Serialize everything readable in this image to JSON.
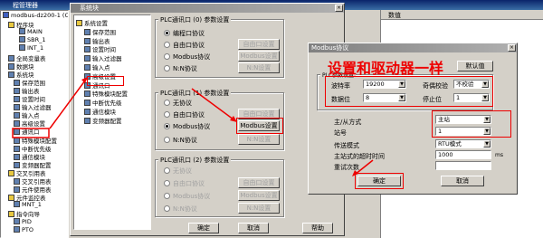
{
  "app": {
    "title": "程管理器"
  },
  "tree": {
    "items": [
      {
        "label": "modbus-dz200-1 (CW",
        "indent": 0,
        "icon": "project-icon"
      },
      {
        "label": "程序块",
        "indent": 1,
        "icon": "folder-icon"
      },
      {
        "label": "MAIN",
        "indent": 3,
        "icon": "block-icon"
      },
      {
        "label": "SBR_1",
        "indent": 3,
        "icon": "block-icon"
      },
      {
        "label": "INT_1",
        "indent": 3,
        "icon": "block-icon"
      },
      {
        "label": "全局变量表",
        "indent": 1,
        "icon": "table-icon"
      },
      {
        "label": "数据块",
        "indent": 1,
        "icon": "data-icon"
      },
      {
        "label": "系统块",
        "indent": 1,
        "icon": "system-icon"
      },
      {
        "label": "保存范围",
        "indent": 2,
        "icon": "item-icon"
      },
      {
        "label": "输出表",
        "indent": 2,
        "icon": "item-icon"
      },
      {
        "label": "设置时间",
        "indent": 2,
        "icon": "item-icon"
      },
      {
        "label": "输入过滤器",
        "indent": 2,
        "icon": "item-icon"
      },
      {
        "label": "输入点",
        "indent": 2,
        "icon": "item-icon"
      },
      {
        "label": "高级设置",
        "indent": 2,
        "icon": "item-icon"
      },
      {
        "label": "通讯口",
        "indent": 2,
        "icon": "item-icon"
      },
      {
        "label": "特殊模块配置",
        "indent": 2,
        "icon": "item-icon"
      },
      {
        "label": "中断优先级",
        "indent": 2,
        "icon": "item-icon"
      },
      {
        "label": "通信模块",
        "indent": 2,
        "icon": "item-icon"
      },
      {
        "label": "变频器配置",
        "indent": 2,
        "icon": "item-icon"
      },
      {
        "label": "交叉引用表",
        "indent": 1,
        "icon": "folder-icon"
      },
      {
        "label": "交叉引用表",
        "indent": 2,
        "icon": "item-icon"
      },
      {
        "label": "元件使用表",
        "indent": 2,
        "icon": "item-icon"
      },
      {
        "label": "元件监控表",
        "indent": 1,
        "icon": "folder-icon"
      },
      {
        "label": "MNT_1",
        "indent": 2,
        "icon": "item-icon"
      },
      {
        "label": "指令向导",
        "indent": 1,
        "icon": "folder-icon"
      },
      {
        "label": "PID",
        "indent": 2,
        "icon": "item-icon"
      },
      {
        "label": "PTO",
        "indent": 2,
        "icon": "item-icon"
      }
    ]
  },
  "bg_panel": {
    "header": "数值"
  },
  "sysblock": {
    "title": "系统块",
    "nav": [
      {
        "label": "系统设置",
        "indent": 0
      },
      {
        "label": "保存范围",
        "indent": 1
      },
      {
        "label": "输出表",
        "indent": 1
      },
      {
        "label": "设置时间",
        "indent": 1
      },
      {
        "label": "输入过滤器",
        "indent": 1
      },
      {
        "label": "输入点",
        "indent": 1
      },
      {
        "label": "高级设置",
        "indent": 1
      },
      {
        "label": "通讯口",
        "indent": 1
      },
      {
        "label": "特殊模块配置",
        "indent": 1
      },
      {
        "label": "中断优先级",
        "indent": 1
      },
      {
        "label": "通信模块",
        "indent": 1
      },
      {
        "label": "变频器配置",
        "indent": 1
      }
    ],
    "group0": {
      "title": "PLC通讯口 (0) 参数设置",
      "options": [
        "编程口协议",
        "自由口协议",
        "Modbus协议",
        "N:N协议"
      ],
      "buttons": [
        "自由口设置",
        "Modbus设置",
        "N:N设置"
      ]
    },
    "group1": {
      "title": "PLC通讯口 (1) 参数设置",
      "options": [
        "无协议",
        "自由口协议",
        "Modbus协议",
        "N:N协议"
      ],
      "buttons": [
        "自由口设置",
        "Modbus设置",
        "N:N设置"
      ]
    },
    "group2": {
      "title": "PLC通讯口 (2) 参数设置",
      "options": [
        "无协议",
        "自由口协议",
        "Modbus协议",
        "N:N协议"
      ],
      "buttons": [
        "自由口设置",
        "Modbus设置",
        "N:N设置"
      ]
    },
    "ok": "确定",
    "cancel": "取消",
    "help": "帮助"
  },
  "modbus": {
    "title": "Modbus协议",
    "annotation": "设置和驱动器一样",
    "default_btn": "默认值",
    "group_title": "PLC参数设置",
    "baud_label": "波特率",
    "baud_value": "19200",
    "parity_label": "奇偶校验",
    "parity_value": "不校验",
    "databits_label": "数据位",
    "databits_value": "8",
    "stopbits_label": "停止位",
    "stopbits_value": "1",
    "mode_label": "主/从方式",
    "mode_value": "主站",
    "station_label": "站号",
    "station_value": "1",
    "transfer_label": "传送模式",
    "transfer_value": "RTU模式",
    "timeout_label": "主站式的超时时间",
    "timeout_value": "1000",
    "timeout_unit": "ms",
    "retry_label": "重试次数",
    "ok": "确定",
    "cancel": "取消"
  }
}
